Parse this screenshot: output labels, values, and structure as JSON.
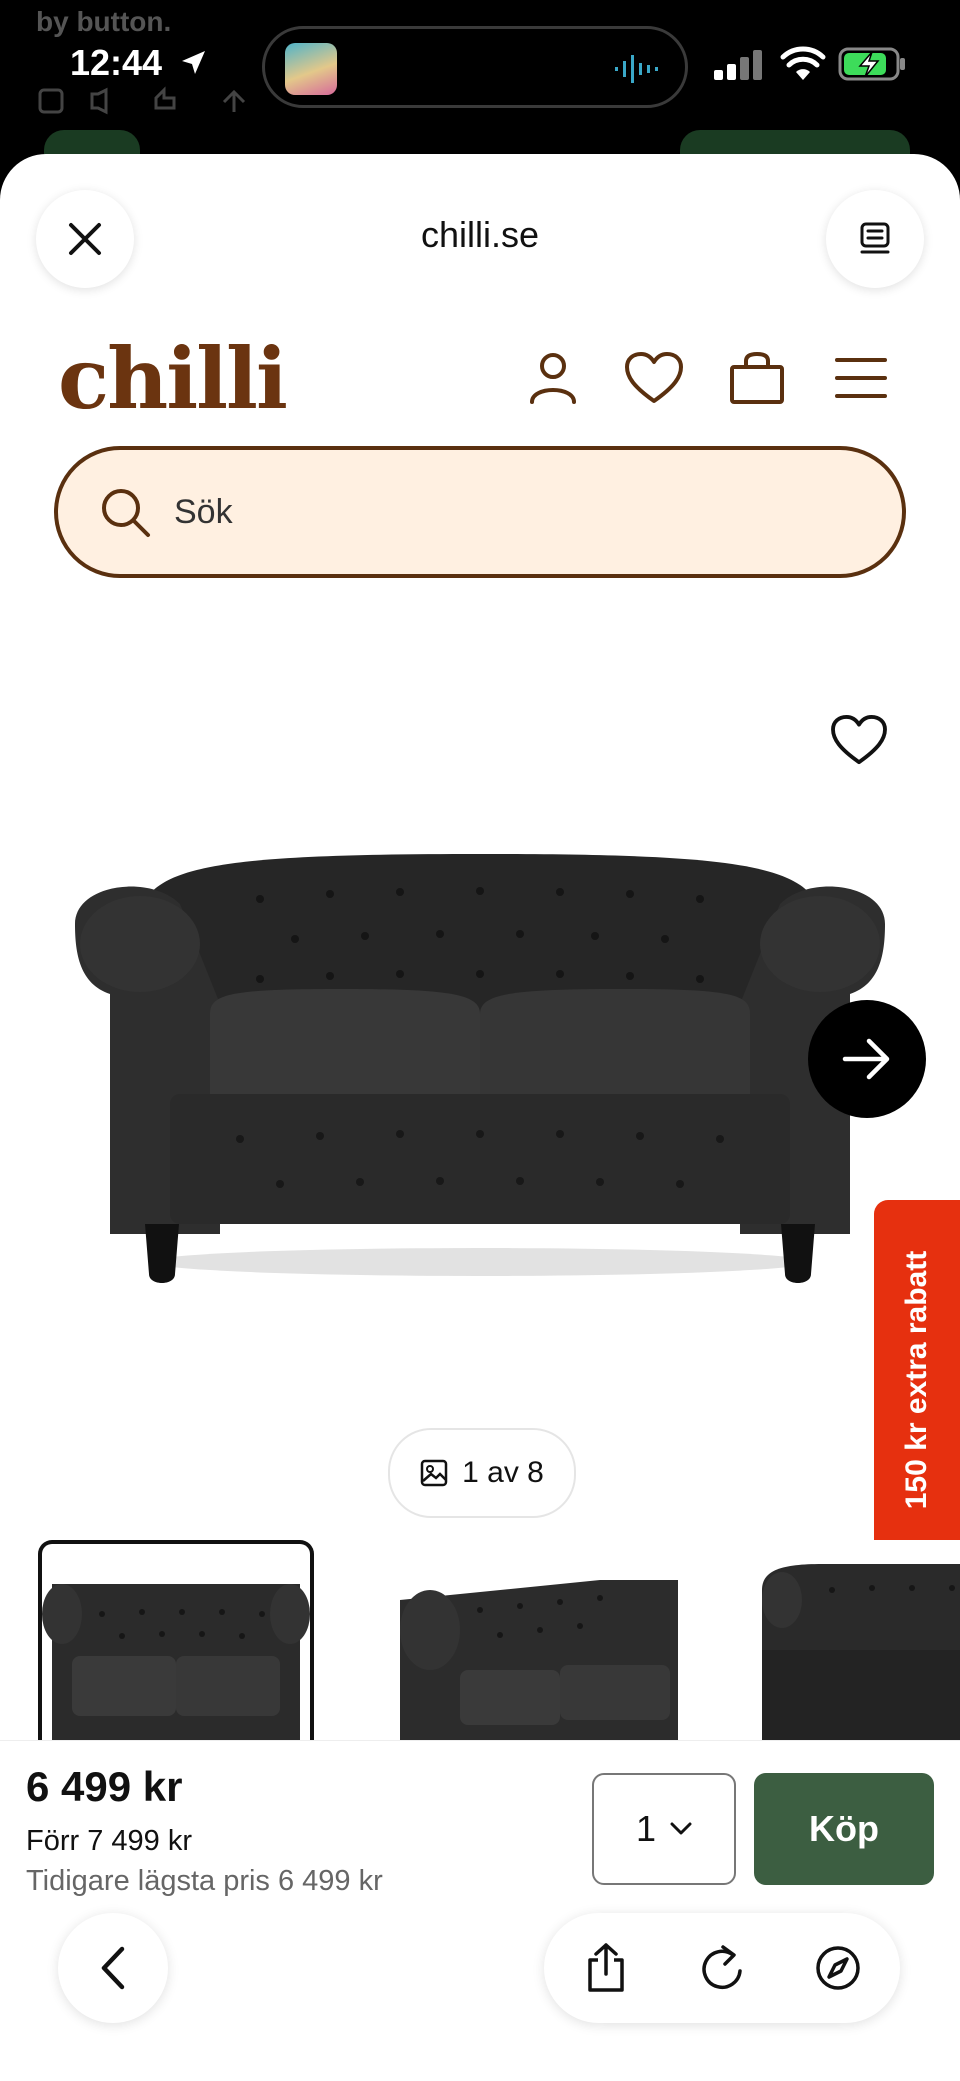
{
  "status_bar": {
    "time": "12:44",
    "background_text": "by button."
  },
  "browser": {
    "domain": "chilli.se"
  },
  "site": {
    "logo": "chilli",
    "search_placeholder": "Sök"
  },
  "product": {
    "image_counter": "1 av 8",
    "promo": "150 kr extra rabatt",
    "price": "6 499 kr",
    "previous_price": "Förr 7 499 kr",
    "lowest_price": "Tidigare lägsta pris 6 499 kr",
    "quantity": "1",
    "buy_label": "Köp"
  },
  "colors": {
    "brand_brown": "#6b3410",
    "search_bg": "#fff0e1",
    "buy_green": "#3c5e41",
    "promo_red": "#e6300f"
  }
}
